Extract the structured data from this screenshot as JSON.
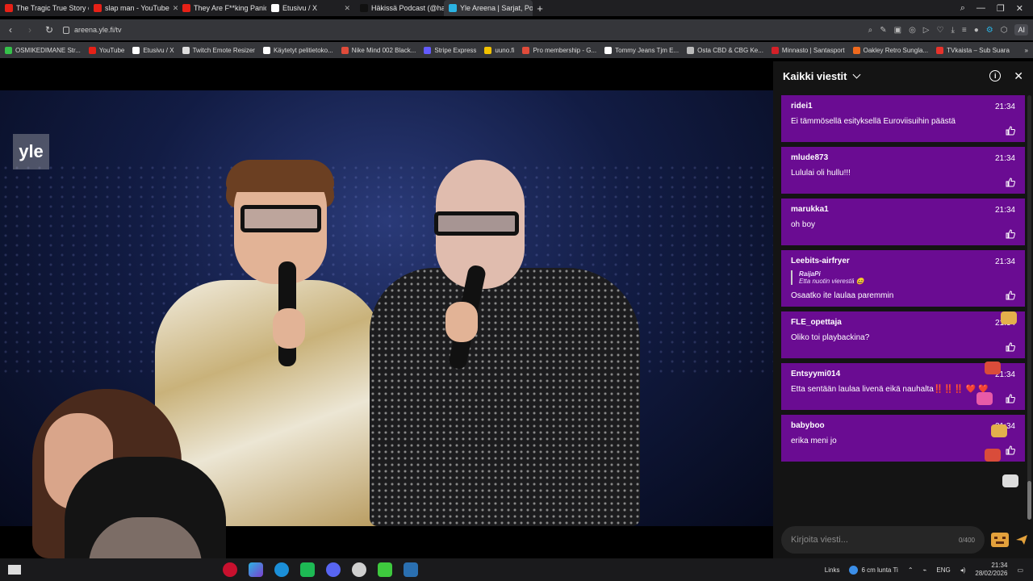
{
  "browser": {
    "tabs": [
      {
        "label": "The Tragic True Story of Ju",
        "color": "#e62117"
      },
      {
        "label": "slap man - YouTube",
        "color": "#e62117"
      },
      {
        "label": "They Are F**king Panickin",
        "color": "#e62117"
      },
      {
        "label": "Etusivu / X",
        "color": "#ffffff"
      },
      {
        "label": "Häkissä Podcast (@hakiss",
        "color": "#111111"
      },
      {
        "label": "Yle Areena | Sarjat, Po",
        "color": "#2bb3e3",
        "active": true
      }
    ],
    "url": "areena.yle.fi/tv",
    "ai_label": "AI"
  },
  "bookmarks": [
    {
      "label": "OSMIKEDIMANE Str...",
      "color": "#35c14a"
    },
    {
      "label": "YouTube",
      "color": "#e62117"
    },
    {
      "label": "Etusivu / X",
      "color": "#ffffff"
    },
    {
      "label": "Twitch Emote Resizer",
      "color": "#dddddd"
    },
    {
      "label": "Käytetyt pelitietoko...",
      "color": "#ffffff"
    },
    {
      "label": "Nike Mind 002 Black...",
      "color": "#e04b3a"
    },
    {
      "label": "Stripe Express",
      "color": "#635bff"
    },
    {
      "label": "uuno.fi",
      "color": "#f2c200"
    },
    {
      "label": "Pro membership - G...",
      "color": "#e04b3a"
    },
    {
      "label": "Tommy Jeans Tjm E...",
      "color": "#ffffff"
    },
    {
      "label": "Osta CBD & CBG Ke...",
      "color": "#bbbbbb"
    },
    {
      "label": "Minnasto | Santasport",
      "color": "#d42028"
    },
    {
      "label": "Oakley Retro Sungla...",
      "color": "#f06a1e"
    },
    {
      "label": "TVkaista – Sub Suara",
      "color": "#e8322b"
    }
  ],
  "video": {
    "logo": "yle"
  },
  "chat": {
    "title": "Kaikki viestit",
    "messages": [
      {
        "user": "ridei1",
        "time": "21:34",
        "text": "Ei tämmösellä esityksellä Euroviisuihin päästä"
      },
      {
        "user": "mlude873",
        "time": "21:34",
        "text": "Lululai oli hullu!!!"
      },
      {
        "user": "marukka1",
        "time": "21:34",
        "text": "oh boy"
      },
      {
        "user": "Leebits-airfryer",
        "time": "21:34",
        "text": "Osaatko ite laulaa paremmin",
        "reply_user": "RaijaPi",
        "reply_text": "Etta nuotin vierestä 😄"
      },
      {
        "user": "FLE_opettaja",
        "time": "21:34",
        "text": "Oliko toi playbackina?"
      },
      {
        "user": "Entsyymi014",
        "time": "21:34",
        "text": "Etta sentään laulaa livenä eikä nauhalta‼️‼️‼️ ❤️ ❤️"
      },
      {
        "user": "babyboo",
        "time": "21:34",
        "text": "erika meni jo"
      }
    ],
    "composer_placeholder": "Kirjoita viesti...",
    "counter": "0/400"
  },
  "taskbar": {
    "links_label": "Links",
    "weather": "6 cm lunta Ti",
    "lang": "ENG",
    "time": "21:34",
    "date": "28/02/2026"
  },
  "colors": {
    "chat_message_bg": "#6a0c92",
    "chat_bg": "#141414",
    "chrome_bg": "#35363a"
  }
}
